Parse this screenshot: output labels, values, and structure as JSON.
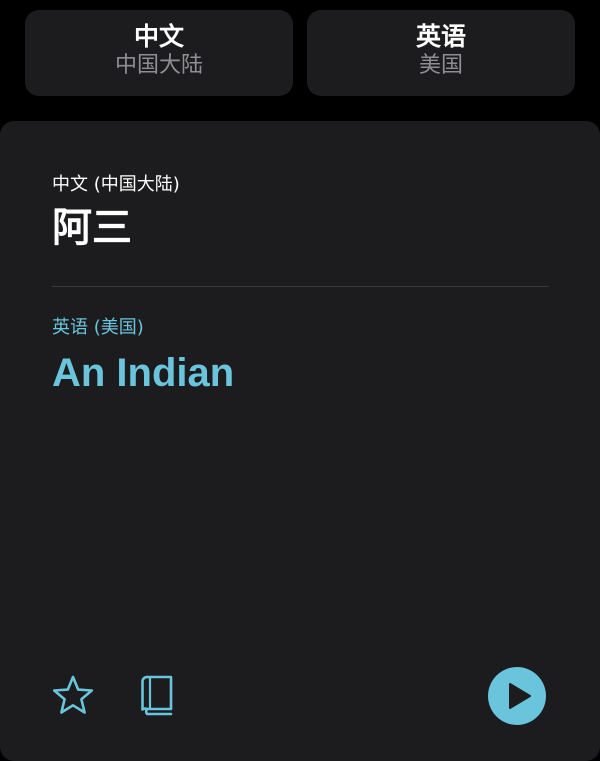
{
  "languages": {
    "source": {
      "name": "中文",
      "region": "中国大陆"
    },
    "target": {
      "name": "英语",
      "region": "美国"
    }
  },
  "translation": {
    "source_label": "中文 (中国大陆)",
    "source_text": "阿三",
    "target_label": "英语 (美国)",
    "target_text": "An Indian"
  },
  "toolbar": {
    "icons": [
      "star-icon",
      "book-icon",
      "play-icon"
    ]
  },
  "colors": {
    "accent": "#6ac4dc",
    "card_background": "#1c1c1e",
    "page_background": "#000000",
    "secondary_text": "#8e8e93"
  }
}
